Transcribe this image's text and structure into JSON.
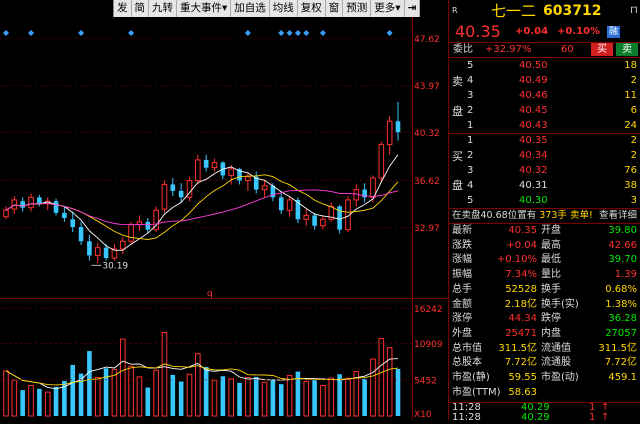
{
  "toolbar": {
    "items": [
      "发",
      "简",
      "九转",
      "重大事件",
      "加自选",
      "均线",
      "复权",
      "窗",
      "预测",
      "更多"
    ],
    "more_arrow": "▾",
    "pin_icon": "⇥",
    "menu_icon": "▾"
  },
  "colors": {
    "up": "#ff3030",
    "down": "#38c8ff",
    "ma5": "#ffffff",
    "ma10": "#ffd700",
    "ma20": "#ff3fd8",
    "event_marker": "#3aa0ff",
    "grid": "#7a0000",
    "price_flat": "#dddddd",
    "price_green": "#00e600"
  },
  "chart_data": [
    {
      "type": "candlestick",
      "y_ticks": [
        "47.62",
        "43.97",
        "40.32",
        "36.62",
        "32.97"
      ],
      "ylim": [
        27.5,
        49.2
      ],
      "low_annotation": "30.19",
      "low_value": 30.19,
      "bottom_marker": "q",
      "event_marker_count": 11,
      "candles_ohlc": [
        [
          33.8,
          34.6,
          33.6,
          34.3
        ],
        [
          34.4,
          35.4,
          34.0,
          35.1
        ],
        [
          35.0,
          35.3,
          34.2,
          34.5
        ],
        [
          34.5,
          35.6,
          34.2,
          35.3
        ],
        [
          35.3,
          35.5,
          34.6,
          34.8
        ],
        [
          34.8,
          35.3,
          34.3,
          35.0
        ],
        [
          35.0,
          35.2,
          33.9,
          34.1
        ],
        [
          34.1,
          34.6,
          33.4,
          33.7
        ],
        [
          33.6,
          34.2,
          32.6,
          33.0
        ],
        [
          33.0,
          33.4,
          31.6,
          31.9
        ],
        [
          31.9,
          32.4,
          30.4,
          30.8
        ],
        [
          30.8,
          31.8,
          30.2,
          31.4
        ],
        [
          31.4,
          31.7,
          30.4,
          30.6
        ],
        [
          30.6,
          31.7,
          30.4,
          31.3
        ],
        [
          31.3,
          32.2,
          30.9,
          31.9
        ],
        [
          31.9,
          33.4,
          31.6,
          33.2
        ],
        [
          33.2,
          33.9,
          32.7,
          33.4
        ],
        [
          33.4,
          33.7,
          32.5,
          32.8
        ],
        [
          32.8,
          34.6,
          32.6,
          34.3
        ],
        [
          34.4,
          36.6,
          34.1,
          36.3
        ],
        [
          36.3,
          36.8,
          35.4,
          35.8
        ],
        [
          35.8,
          36.4,
          34.9,
          35.3
        ],
        [
          35.3,
          36.9,
          35.0,
          36.6
        ],
        [
          36.6,
          38.6,
          36.3,
          38.2
        ],
        [
          38.2,
          38.6,
          37.3,
          37.6
        ],
        [
          37.6,
          38.3,
          37.3,
          38.0
        ],
        [
          38.0,
          38.1,
          36.7,
          37.0
        ],
        [
          37.0,
          37.8,
          36.3,
          37.5
        ],
        [
          37.5,
          37.6,
          36.3,
          36.6
        ],
        [
          36.6,
          37.2,
          35.8,
          36.9
        ],
        [
          36.9,
          37.3,
          35.6,
          35.9
        ],
        [
          35.9,
          36.6,
          35.3,
          36.2
        ],
        [
          36.2,
          36.4,
          35.0,
          35.3
        ],
        [
          35.3,
          35.8,
          34.0,
          34.3
        ],
        [
          34.3,
          35.4,
          33.8,
          35.1
        ],
        [
          35.1,
          35.3,
          33.3,
          33.6
        ],
        [
          33.6,
          34.4,
          33.1,
          33.9
        ],
        [
          33.9,
          34.1,
          32.8,
          33.1
        ],
        [
          33.1,
          33.9,
          32.8,
          33.6
        ],
        [
          33.6,
          34.9,
          33.4,
          34.6
        ],
        [
          34.6,
          34.7,
          32.5,
          32.8
        ],
        [
          32.8,
          35.4,
          32.6,
          35.1
        ],
        [
          35.1,
          36.3,
          34.6,
          35.9
        ],
        [
          35.9,
          36.4,
          34.9,
          35.3
        ],
        [
          35.3,
          37.0,
          34.9,
          36.8
        ],
        [
          36.8,
          39.6,
          36.5,
          39.4
        ],
        [
          39.4,
          41.6,
          38.6,
          41.2
        ],
        [
          41.2,
          42.7,
          39.7,
          40.35
        ]
      ],
      "ma5_indicative": true,
      "ma10_indicative": true
    },
    {
      "type": "bar",
      "name_printed": "",
      "y_ticks": [
        "16242",
        "10909",
        "5452"
      ],
      "unit_label": "X10",
      "ylim": [
        0,
        17500
      ],
      "volumes": [
        6800,
        5400,
        3900,
        4600,
        4100,
        3600,
        4400,
        5300,
        7700,
        6400,
        9800,
        5800,
        7200,
        7000,
        11600,
        7500,
        5900,
        4300,
        6900,
        12600,
        6200,
        5200,
        6300,
        9400,
        7400,
        5400,
        6000,
        5600,
        5000,
        5800,
        5900,
        5100,
        5500,
        4800,
        6100,
        6700,
        5200,
        5400,
        4600,
        5700,
        6300,
        5700,
        6700,
        5600,
        8600,
        11700,
        10300,
        7100
      ]
    }
  ],
  "quote": {
    "label_r": "R",
    "name": "七一二",
    "code": "603712",
    "price": "40.35",
    "change": "+0.04",
    "change_pct": "+0.10%",
    "tag": "融",
    "weibi_label": "委比",
    "weibi_value": "+32.97%",
    "weicha_value": "60",
    "buy_btn": "买",
    "sell_btn": "卖"
  },
  "orderbook": {
    "sell_labels": [
      "卖",
      "盘"
    ],
    "buy_labels": [
      "买",
      "盘"
    ],
    "asks": [
      {
        "lvl": "5",
        "price": "40.50",
        "vol": "18"
      },
      {
        "lvl": "4",
        "price": "40.49",
        "vol": "2"
      },
      {
        "lvl": "3",
        "price": "40.46",
        "vol": "11"
      },
      {
        "lvl": "2",
        "price": "40.45",
        "vol": "6"
      },
      {
        "lvl": "1",
        "price": "40.43",
        "vol": "24"
      }
    ],
    "bids": [
      {
        "lvl": "1",
        "price": "40.35",
        "vol": "2"
      },
      {
        "lvl": "2",
        "price": "40.34",
        "vol": "2"
      },
      {
        "lvl": "3",
        "price": "40.32",
        "vol": "76"
      },
      {
        "lvl": "4",
        "price": "40.31",
        "vol": "38"
      },
      {
        "lvl": "5",
        "price": "40.30",
        "vol": "3"
      }
    ]
  },
  "notice": {
    "text_a": "在卖盘",
    "text_b": "40.68",
    "text_c": "位置有",
    "text_d": "373手",
    "text_e": "卖单!",
    "link": "查看详细"
  },
  "stats": [
    {
      "l1": "最新",
      "v1": "40.35",
      "l2": "开盘",
      "v2": "39.80"
    },
    {
      "l1": "涨跌",
      "v1": "+0.04",
      "l2": "最高",
      "v2": "42.66"
    },
    {
      "l1": "涨幅",
      "v1": "+0.10%",
      "l2": "最低",
      "v2": "39.70"
    },
    {
      "l1": "振幅",
      "v1": "7.34%",
      "l2": "量比",
      "v2": "1.39"
    },
    {
      "l1": "总手",
      "v1": "52528",
      "l2": "换手",
      "v2": "0.68%"
    },
    {
      "l1": "金额",
      "v1": "2.18亿",
      "l2": "换手(实)",
      "v2": "1.38%"
    },
    {
      "l1": "涨停",
      "v1": "44.34",
      "l2": "跌停",
      "v2": "36.28"
    },
    {
      "l1": "外盘",
      "v1": "25471",
      "l2": "内盘",
      "v2": "27057"
    },
    {
      "l1": "总市值",
      "v1": "311.5亿",
      "l2": "流通值",
      "v2": "311.5亿"
    },
    {
      "l1": "总股本",
      "v1": "7.72亿",
      "l2": "流通股",
      "v2": "7.72亿"
    },
    {
      "l1": "市盈(静)",
      "v1": "59.55",
      "l2": "市盈(动)",
      "v2": "459.1"
    },
    {
      "l1": "市盈(TTM)",
      "v1": "58.63",
      "l2": "",
      "v2": ""
    }
  ],
  "ticks": [
    {
      "time": "11:28",
      "price": "40.29",
      "vol": "1",
      "dir": "↑"
    },
    {
      "time": "11:28",
      "price": "40.29",
      "vol": "1",
      "dir": "↑"
    }
  ]
}
